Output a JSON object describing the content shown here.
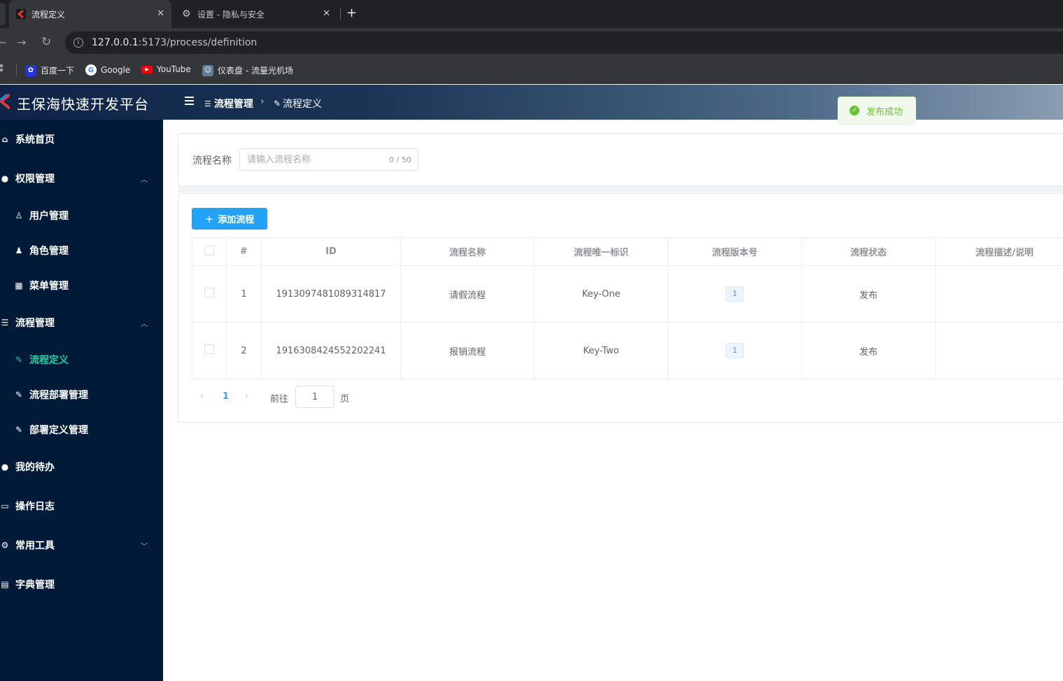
{
  "browser": {
    "tabs": [
      {
        "title": "流程定义",
        "active": true
      },
      {
        "title": "设置 - 隐私与安全",
        "active": false
      }
    ],
    "url_host": "127.0.0.1",
    "url_path": ":5173/process/definition",
    "bookmarks": [
      "百度一下",
      "Google",
      "YouTube",
      "仪表盘 - 流量光机场"
    ]
  },
  "app": {
    "title": "王保海快速开发平台",
    "breadcrumb": [
      "流程管理",
      "流程定义"
    ]
  },
  "toast": {
    "message": "发布成功",
    "color": "#67c23a"
  },
  "sidebar": {
    "items": [
      {
        "label": "系统首页",
        "icon": "home-icon",
        "level": 1
      },
      {
        "label": "权限管理",
        "icon": "user-icon",
        "level": 1,
        "expanded": true
      },
      {
        "label": "用户管理",
        "icon": "user-outline-icon",
        "level": 2
      },
      {
        "label": "角色管理",
        "icon": "user-icon",
        "level": 2
      },
      {
        "label": "菜单管理",
        "icon": "grid-icon",
        "level": 2
      },
      {
        "label": "流程管理",
        "icon": "sliders-icon",
        "level": 1,
        "expanded": true
      },
      {
        "label": "流程定义",
        "icon": "edit-icon",
        "level": 2,
        "active": true
      },
      {
        "label": "流程部署管理",
        "icon": "edit-icon",
        "level": 2
      },
      {
        "label": "部署定义管理",
        "icon": "edit-icon",
        "level": 2
      },
      {
        "label": "我的待办",
        "icon": "user-icon",
        "level": 1
      },
      {
        "label": "操作日志",
        "icon": "comment-icon",
        "level": 1
      },
      {
        "label": "常用工具",
        "icon": "gear-icon",
        "level": 1,
        "expanded": false
      },
      {
        "label": "字典管理",
        "icon": "clipboard-icon",
        "level": 1
      }
    ],
    "active_color": "#1cd3a4"
  },
  "search": {
    "label": "流程名称",
    "placeholder": "请输入流程名称",
    "count": "0 / 50"
  },
  "toolbar": {
    "add_label": "添加流程"
  },
  "table": {
    "columns": [
      "#",
      "ID",
      "流程名称",
      "流程唯一标识",
      "流程版本号",
      "流程状态",
      "流程描述/说明"
    ],
    "rows": [
      {
        "index": "1",
        "id": "1913097481089314817",
        "name": "请假流程",
        "key": "Key-One",
        "version": "1",
        "status": "发布",
        "desc": ""
      },
      {
        "index": "2",
        "id": "1916308424552202241",
        "name": "报销流程",
        "key": "Key-Two",
        "version": "1",
        "status": "发布",
        "desc": ""
      }
    ]
  },
  "pagination": {
    "current": "1",
    "goto_label": "前往",
    "goto_value": "1",
    "page_unit": "页"
  }
}
